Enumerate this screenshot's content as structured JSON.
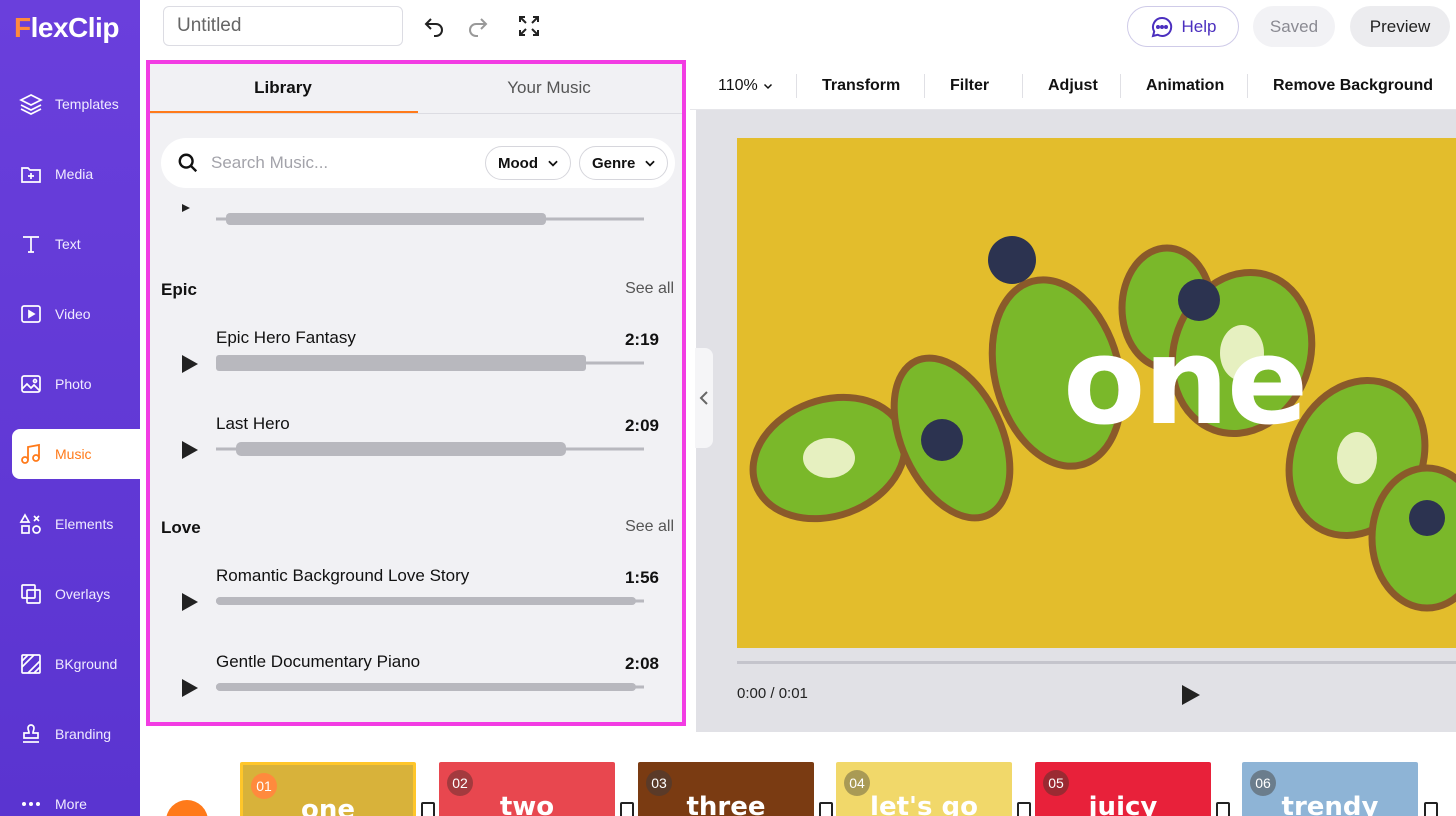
{
  "app": {
    "brand": "FlexClip",
    "project_title": "Untitled"
  },
  "colors": {
    "sidebar": "#5a34d0",
    "accent": "#ff7a1a",
    "panel_outline": "#f23ce3",
    "stage_bg": "#e3bd2c"
  },
  "sidebar": {
    "items": [
      {
        "label": "Templates",
        "icon": "layers-icon"
      },
      {
        "label": "Media",
        "icon": "folder-plus-icon"
      },
      {
        "label": "Text",
        "icon": "text-icon"
      },
      {
        "label": "Video",
        "icon": "video-icon"
      },
      {
        "label": "Photo",
        "icon": "photo-icon"
      },
      {
        "label": "Music",
        "icon": "music-icon",
        "active": true
      },
      {
        "label": "Elements",
        "icon": "shapes-icon"
      },
      {
        "label": "Overlays",
        "icon": "overlays-icon"
      },
      {
        "label": "BKground",
        "icon": "background-icon"
      },
      {
        "label": "Branding",
        "icon": "stamp-icon"
      },
      {
        "label": "More",
        "icon": "more-icon"
      }
    ]
  },
  "topbar": {
    "help": "Help",
    "saved": "Saved",
    "preview": "Preview"
  },
  "music_panel": {
    "tabs": [
      {
        "label": "Library",
        "active": true
      },
      {
        "label": "Your Music"
      }
    ],
    "search_placeholder": "Search Music...",
    "filters": [
      "Mood",
      "Genre"
    ],
    "sections": [
      {
        "title": "Epic",
        "see_all": "See all",
        "tracks": [
          {
            "name": "Epic Hero Fantasy",
            "duration": "2:19"
          },
          {
            "name": "Last Hero",
            "duration": "2:09"
          }
        ]
      },
      {
        "title": "Love",
        "see_all": "See all",
        "tracks": [
          {
            "name": "Romantic Background Love Story",
            "duration": "1:56"
          },
          {
            "name": "Gentle Documentary Piano",
            "duration": "2:08"
          }
        ]
      }
    ]
  },
  "toolbar": {
    "zoom": "110%",
    "tools": [
      "Transform",
      "Filter",
      "Adjust",
      "Animation",
      "Remove Background"
    ]
  },
  "stage": {
    "text": "one",
    "time": "0:00 / 0:01"
  },
  "timeline": {
    "clips": [
      {
        "num": "01",
        "text": "one",
        "color": "#d8b23a",
        "badge": "#ff8a3d"
      },
      {
        "num": "02",
        "text": "two",
        "color": "#e8474f",
        "badge": "#a33a3e"
      },
      {
        "num": "03",
        "text": "three",
        "color": "#7a3b12",
        "badge": "#5a3a28"
      },
      {
        "num": "04",
        "text": "let's go",
        "color": "#f1d86a",
        "badge": "#a99a55"
      },
      {
        "num": "05",
        "text": "juicy",
        "color": "#e8213a",
        "badge": "#9a2a32"
      },
      {
        "num": "06",
        "text": "trendy",
        "color": "#8eb4d6",
        "badge": "#6b7d8c"
      }
    ]
  }
}
